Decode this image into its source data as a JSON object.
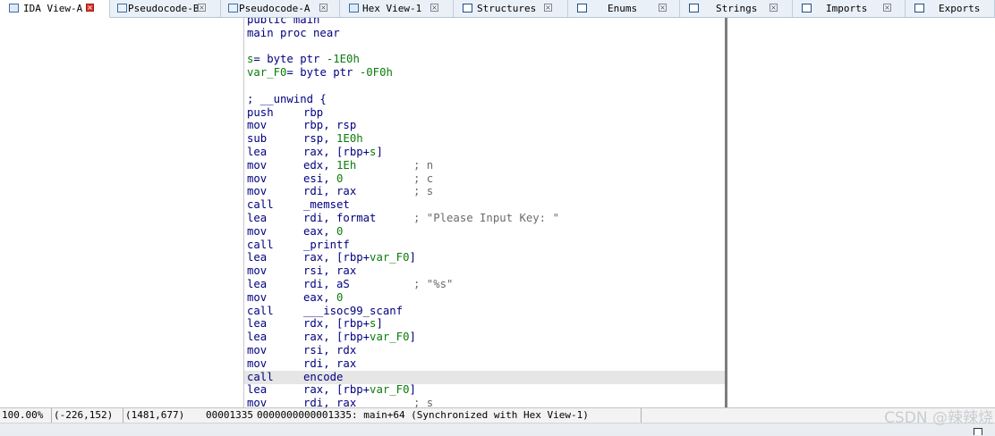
{
  "tabs": [
    {
      "label": "IDA View-A",
      "icon": "disasm-view-icon",
      "active": true
    },
    {
      "label": "Pseudocode-B",
      "icon": "pseudocode-icon",
      "active": false
    },
    {
      "label": "Pseudocode-A",
      "icon": "pseudocode-icon",
      "active": false
    },
    {
      "label": "Hex View-1",
      "icon": "hex-view-icon",
      "active": false
    },
    {
      "label": "Structures",
      "icon": "structures-icon",
      "active": false
    },
    {
      "label": "Enums",
      "icon": "enums-icon",
      "active": false
    },
    {
      "label": "Strings",
      "icon": "strings-icon",
      "active": false
    },
    {
      "label": "Imports",
      "icon": "imports-icon",
      "active": false
    },
    {
      "label": "Exports",
      "icon": "exports-icon",
      "active": false
    }
  ],
  "disasm": {
    "header_partial": "public main",
    "proc_line": "main proc near",
    "vars": [
      {
        "name": "s",
        "text": "= byte ptr ",
        "value": "-1E0h"
      },
      {
        "name": "var_F0",
        "text": "= byte ptr ",
        "value": "-0F0h"
      }
    ],
    "unwind": "; __unwind {",
    "instructions": [
      {
        "m": "push",
        "o": [
          [
            "rbp",
            "kw"
          ]
        ],
        "c": ""
      },
      {
        "m": "mov",
        "o": [
          [
            "rbp, rsp",
            "kw"
          ]
        ],
        "c": ""
      },
      {
        "m": "sub",
        "o": [
          [
            "rsp, ",
            "kw"
          ],
          [
            "1E0h",
            "num"
          ]
        ],
        "c": ""
      },
      {
        "m": "lea",
        "o": [
          [
            "rax, [rbp+",
            "kw"
          ],
          [
            "s",
            "var"
          ],
          [
            "]",
            "kw"
          ]
        ],
        "c": ""
      },
      {
        "m": "mov",
        "o": [
          [
            "edx, ",
            "kw"
          ],
          [
            "1Eh",
            "num"
          ]
        ],
        "c": "; n"
      },
      {
        "m": "mov",
        "o": [
          [
            "esi, ",
            "kw"
          ],
          [
            "0",
            "num"
          ]
        ],
        "c": "; c"
      },
      {
        "m": "mov",
        "o": [
          [
            "rdi, rax",
            "kw"
          ]
        ],
        "c": "; s"
      },
      {
        "m": "call",
        "o": [
          [
            "_memset",
            "fn"
          ]
        ],
        "c": ""
      },
      {
        "m": "lea",
        "o": [
          [
            "rdi, format",
            "kw"
          ]
        ],
        "c": "; \"Please Input Key: \""
      },
      {
        "m": "mov",
        "o": [
          [
            "eax, ",
            "kw"
          ],
          [
            "0",
            "num"
          ]
        ],
        "c": ""
      },
      {
        "m": "call",
        "o": [
          [
            "_printf",
            "fn"
          ]
        ],
        "c": ""
      },
      {
        "m": "lea",
        "o": [
          [
            "rax, [rbp+",
            "kw"
          ],
          [
            "var_F0",
            "var"
          ],
          [
            "]",
            "kw"
          ]
        ],
        "c": ""
      },
      {
        "m": "mov",
        "o": [
          [
            "rsi, rax",
            "kw"
          ]
        ],
        "c": ""
      },
      {
        "m": "lea",
        "o": [
          [
            "rdi, aS",
            "kw"
          ]
        ],
        "c": "; \"%s\""
      },
      {
        "m": "mov",
        "o": [
          [
            "eax, ",
            "kw"
          ],
          [
            "0",
            "num"
          ]
        ],
        "c": ""
      },
      {
        "m": "call",
        "o": [
          [
            "___isoc99_scanf",
            "fn"
          ]
        ],
        "c": ""
      },
      {
        "m": "lea",
        "o": [
          [
            "rdx, [rbp+",
            "kw"
          ],
          [
            "s",
            "var"
          ],
          [
            "]",
            "kw"
          ]
        ],
        "c": ""
      },
      {
        "m": "lea",
        "o": [
          [
            "rax, [rbp+",
            "kw"
          ],
          [
            "var_F0",
            "var"
          ],
          [
            "]",
            "kw"
          ]
        ],
        "c": ""
      },
      {
        "m": "mov",
        "o": [
          [
            "rsi, rdx",
            "kw"
          ]
        ],
        "c": ""
      },
      {
        "m": "mov",
        "o": [
          [
            "rdi, rax",
            "kw"
          ]
        ],
        "c": ""
      },
      {
        "m": "call",
        "o": [
          [
            "encode",
            "fn"
          ]
        ],
        "c": "",
        "highlight": true
      },
      {
        "m": "lea",
        "o": [
          [
            "rax, [rbp+",
            "kw"
          ],
          [
            "var_F0",
            "var"
          ],
          [
            "]",
            "kw"
          ]
        ],
        "c": ""
      },
      {
        "m": "mov",
        "o": [
          [
            "rdi, rax",
            "kw"
          ]
        ],
        "c": "; s"
      }
    ]
  },
  "status": {
    "zoom": "100.00%",
    "graph_coords": "(-226,152)",
    "mouse_coords": "(1481,677)",
    "file_offset": "00001335",
    "address": "0000000000001335: main+64 (Synchronized with Hex View-1)"
  },
  "watermark": "CSDN @辣辣烧",
  "colors": {
    "code": "#000080",
    "number": "#0b7a0b",
    "comment": "#6b6b6b",
    "highlight_row": "#e6e6e6",
    "active_tab_close": "#d9342b"
  }
}
